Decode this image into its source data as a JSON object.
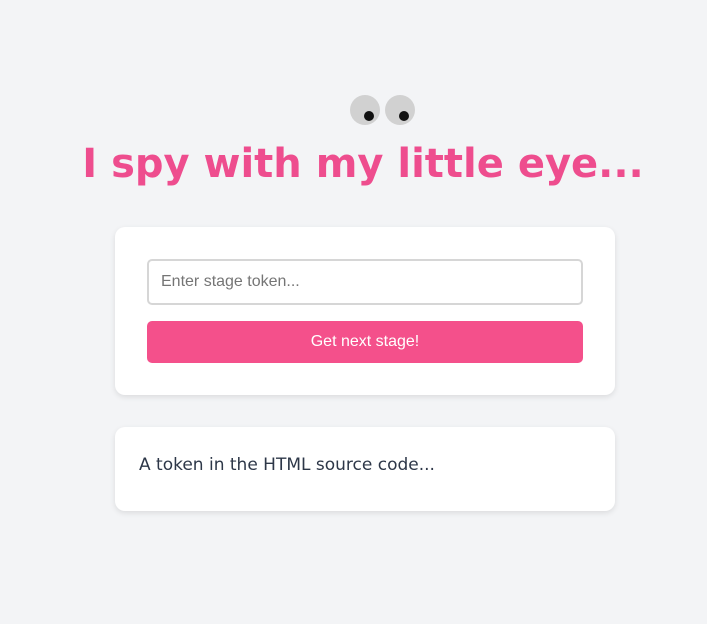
{
  "header": {
    "title": "I spy with my little eye...",
    "icon": "googly-eyes-icon",
    "title_color": "#ee4d8e"
  },
  "form": {
    "input": {
      "placeholder": "Enter stage token...",
      "value": ""
    },
    "submit_label": "Get next stage!",
    "button_color": "#f4508b"
  },
  "hint": {
    "text": "A token in the HTML source code..."
  }
}
